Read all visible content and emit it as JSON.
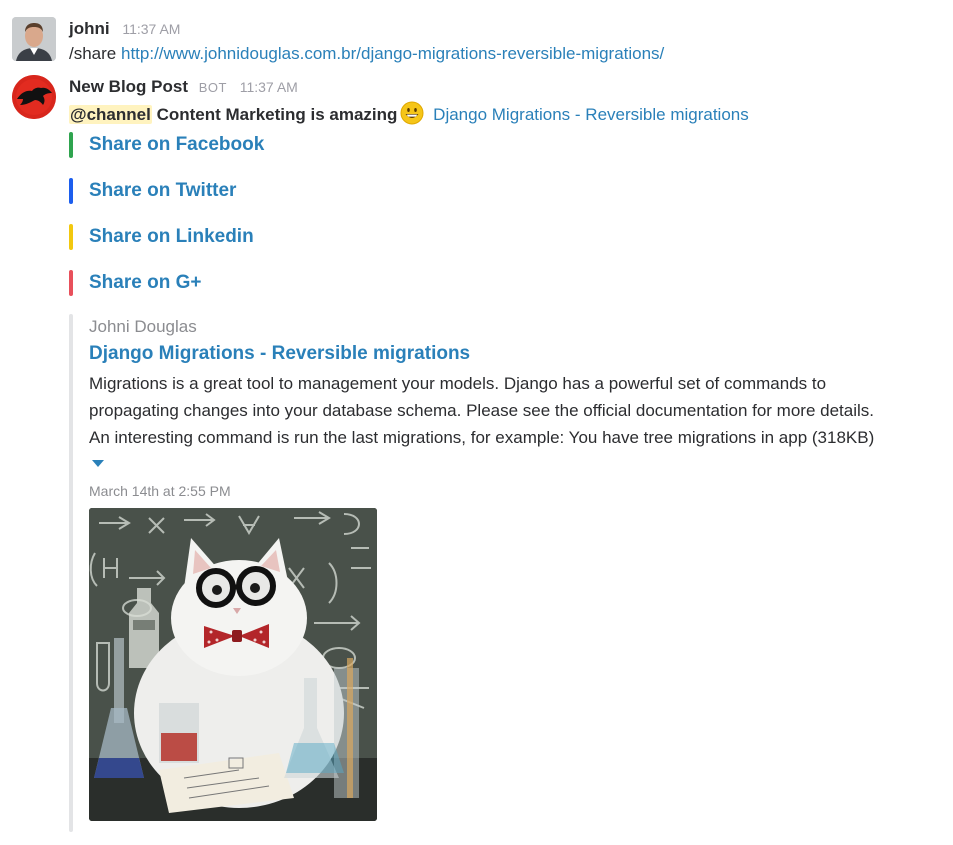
{
  "messages": [
    {
      "sender": "johni",
      "time": "11:37 AM",
      "command": "/share",
      "link": "http://www.johnidouglas.com.br/django-migrations-reversible-migrations/"
    },
    {
      "sender": "New Blog Post",
      "badge": "BOT",
      "time": "11:37 AM",
      "mention": "@channel",
      "text": "Content Marketing is amazing",
      "emoji": "grinning-face-emoji",
      "link_text": "Django Migrations - Reversible migrations"
    }
  ],
  "share_links": [
    {
      "label": "Share on Facebook",
      "color": "#2fa44f"
    },
    {
      "label": "Share on Twitter",
      "color": "#1c5eee"
    },
    {
      "label": "Share on Linkedin",
      "color": "#f2c80f"
    },
    {
      "label": "Share on G+",
      "color": "#e8505b"
    }
  ],
  "attachment": {
    "author": "Johni Douglas",
    "title": "Django Migrations - Reversible migrations",
    "text_lines": [
      "Migrations is a great tool to management your models. Django has a powerful set of commands to",
      "propagating changes into your database schema. Please see the official documentation for more details.",
      "An interesting command is run the last migrations, for example: You have tree migrations in app (318KB)"
    ],
    "expand_icon": "caret-down-icon",
    "date": "March 14th at 2:55 PM",
    "image": "cat-scientist-meme-image"
  },
  "colors": {
    "link": "#2a80b9",
    "mention_bg": "#fff3bf",
    "attachment_bar": "#e3e4e6"
  }
}
